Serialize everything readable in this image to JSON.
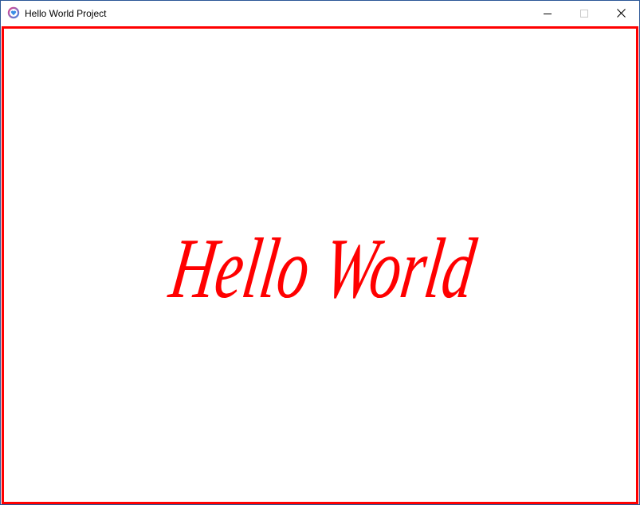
{
  "window": {
    "title": "Hello World Project",
    "accent_color": "#2b5797"
  },
  "titlebar": {
    "app_icon": "heart-app-icon",
    "controls": {
      "minimize_icon": "minimize-icon",
      "maximize_icon": "maximize-icon",
      "close_icon": "close-icon"
    }
  },
  "content": {
    "border_color": "#ff0000",
    "text": "Hello World",
    "text_color": "#ff0000"
  }
}
